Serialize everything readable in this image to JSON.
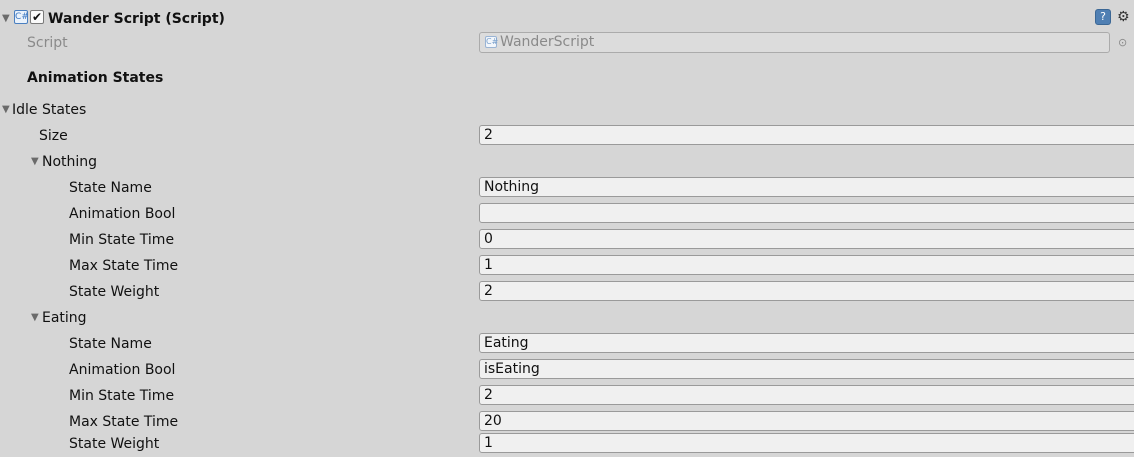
{
  "component": {
    "title": "Wander Script (Script)",
    "enabled_mark": "✔",
    "help_glyph": "?",
    "gear_glyph": "⚙",
    "script_label": "Script",
    "script_value": "WanderScript",
    "picker_glyph": "⊙"
  },
  "section": {
    "heading": "Animation States",
    "group_label": "Idle States",
    "size_label": "Size",
    "size_value": "2"
  },
  "states": [
    {
      "name": "Nothing",
      "fields": [
        {
          "label": "State Name",
          "value": "Nothing"
        },
        {
          "label": "Animation Bool",
          "value": ""
        },
        {
          "label": "Min State Time",
          "value": "0"
        },
        {
          "label": "Max State Time",
          "value": "1"
        },
        {
          "label": "State Weight",
          "value": "2"
        }
      ]
    },
    {
      "name": "Eating",
      "fields": [
        {
          "label": "State Name",
          "value": "Eating"
        },
        {
          "label": "Animation Bool",
          "value": "isEating"
        },
        {
          "label": "Min State Time",
          "value": "2"
        },
        {
          "label": "Max State Time",
          "value": "20"
        },
        {
          "label": "State Weight",
          "value": "1"
        }
      ]
    }
  ],
  "glyphs": {
    "foldout_open": "▼",
    "script_icon": "C#"
  }
}
